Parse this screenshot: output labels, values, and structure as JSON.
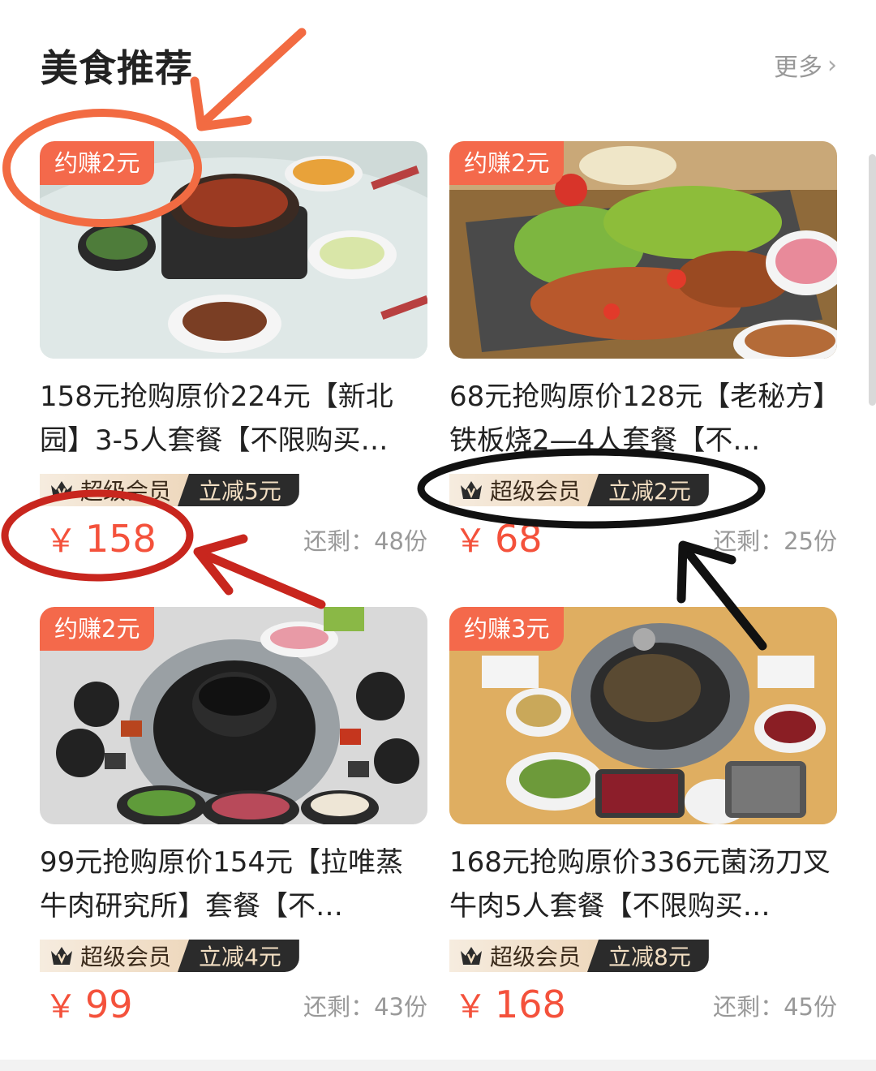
{
  "section": {
    "title": "美食推荐",
    "more_label": "更多",
    "more_icon": "chevron-right-icon"
  },
  "products": [
    {
      "earn_label": "约赚2元",
      "title": "158元抢购原价224元【新北园】3-5人套餐【不限购买…",
      "vip_label": "超级会员",
      "discount_label": "立减5元",
      "currency": "￥",
      "price": "158",
      "stock_label": "还剩：48份"
    },
    {
      "earn_label": "约赚2元",
      "title": "68元抢购原价128元【老秘方】铁板烧2—4人套餐【不…",
      "vip_label": "超级会员",
      "discount_label": "立减2元",
      "currency": "￥",
      "price": "68",
      "stock_label": "还剩：25份"
    },
    {
      "earn_label": "约赚2元",
      "title": "99元抢购原价154元【拉唯蒸牛肉研究所】套餐【不…",
      "vip_label": "超级会员",
      "discount_label": "立减4元",
      "currency": "￥",
      "price": "99",
      "stock_label": "还剩：43份"
    },
    {
      "earn_label": "约赚3元",
      "title": "168元抢购原价336元菌汤刀叉牛肉5人套餐【不限购买…",
      "vip_label": "超级会员",
      "discount_label": "立减8元",
      "currency": "￥",
      "price": "168",
      "stock_label": "还剩：45份"
    }
  ],
  "colors": {
    "accent_red": "#f4513b",
    "earn_badge": "#f4694b",
    "annotation_orange": "#f26b42",
    "annotation_darkred": "#c8261e",
    "annotation_black": "#111111"
  }
}
